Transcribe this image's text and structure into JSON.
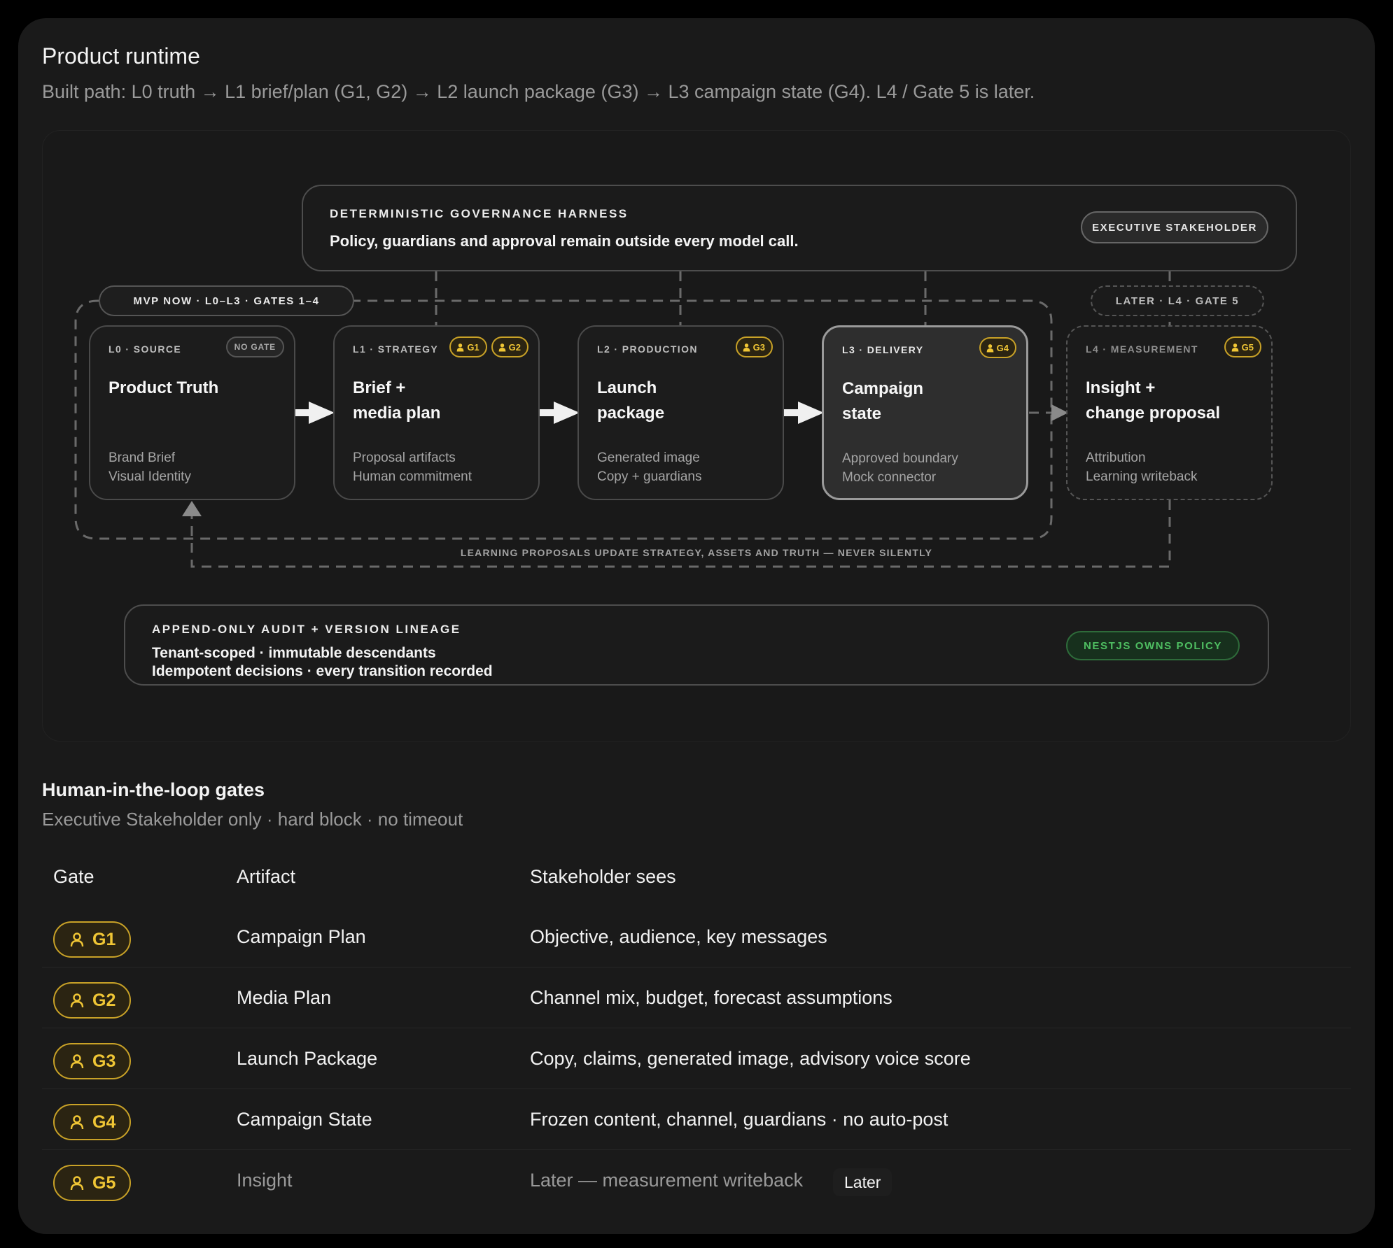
{
  "header": {
    "title": "Product runtime",
    "subtitle": "Built path: L0 truth → L1 brief/plan (G1, G2) → L2 launch package (G3) → L3 campaign state (G4). L4 / Gate 5 is later."
  },
  "harness": {
    "caption": "DETERMINISTIC GOVERNANCE HARNESS",
    "text": "Policy, guardians and approval remain outside every model call.",
    "badge": "EXECUTIVE STAKEHOLDER"
  },
  "scope": {
    "mvp": "MVP NOW · L0–L3 · GATES 1–4",
    "later": "LATER · L4 · GATE 5"
  },
  "stages": [
    {
      "level": "L0 · SOURCE",
      "name": "Product Truth",
      "desc": "Brand Brief\nVisual Identity",
      "nogate": "NO GATE",
      "gates": []
    },
    {
      "level": "L1 · STRATEGY",
      "name": "Brief +\nmedia plan",
      "desc": "Proposal artifacts\nHuman commitment",
      "gates": [
        "G1",
        "G2"
      ]
    },
    {
      "level": "L2 · PRODUCTION",
      "name": "Launch\npackage",
      "desc": "Generated image\nCopy + guardians",
      "gates": [
        "G3"
      ]
    },
    {
      "level": "L3 · DELIVERY",
      "name": "Campaign\nstate",
      "desc": "Approved boundary\nMock connector",
      "gates": [
        "G4"
      ]
    },
    {
      "level": "L4 · MEASUREMENT",
      "name": "Insight +\nchange proposal",
      "desc": "Attribution\nLearning writeback",
      "gates": [
        "G5"
      ]
    }
  ],
  "feedback": "LEARNING PROPOSALS UPDATE STRATEGY, ASSETS AND TRUTH — NEVER SILENTLY",
  "audit": {
    "caption": "APPEND-ONLY AUDIT + VERSION LINEAGE",
    "line1": "Tenant-scoped · immutable descendants",
    "line2": "Idempotent decisions · every transition recorded",
    "badge": "NESTJS OWNS POLICY"
  },
  "gates_section": {
    "title": "Human-in-the-loop gates",
    "subtitle": "Executive Stakeholder only · hard block · no timeout",
    "columns": [
      "Gate",
      "Artifact",
      "Stakeholder sees"
    ],
    "rows": [
      {
        "gate": "G1",
        "artifact": "Campaign Plan",
        "sees": "Objective, audience, key messages"
      },
      {
        "gate": "G2",
        "artifact": "Media Plan",
        "sees": "Channel mix, budget, forecast assumptions"
      },
      {
        "gate": "G3",
        "artifact": "Launch Package",
        "sees": "Copy, claims, generated image, advisory voice score"
      },
      {
        "gate": "G4",
        "artifact": "Campaign State",
        "sees": "Frozen content, channel, guardians · no auto-post"
      },
      {
        "gate": "G5",
        "artifact": "Insight",
        "sees": "Later — measurement writeback",
        "tag": "Later"
      }
    ]
  },
  "colors": {
    "gate_accent": "#f0c635",
    "policy_green": "#4fbf62"
  },
  "icons": {
    "gate": "person-icon",
    "arrow": "arrow-right-icon"
  }
}
